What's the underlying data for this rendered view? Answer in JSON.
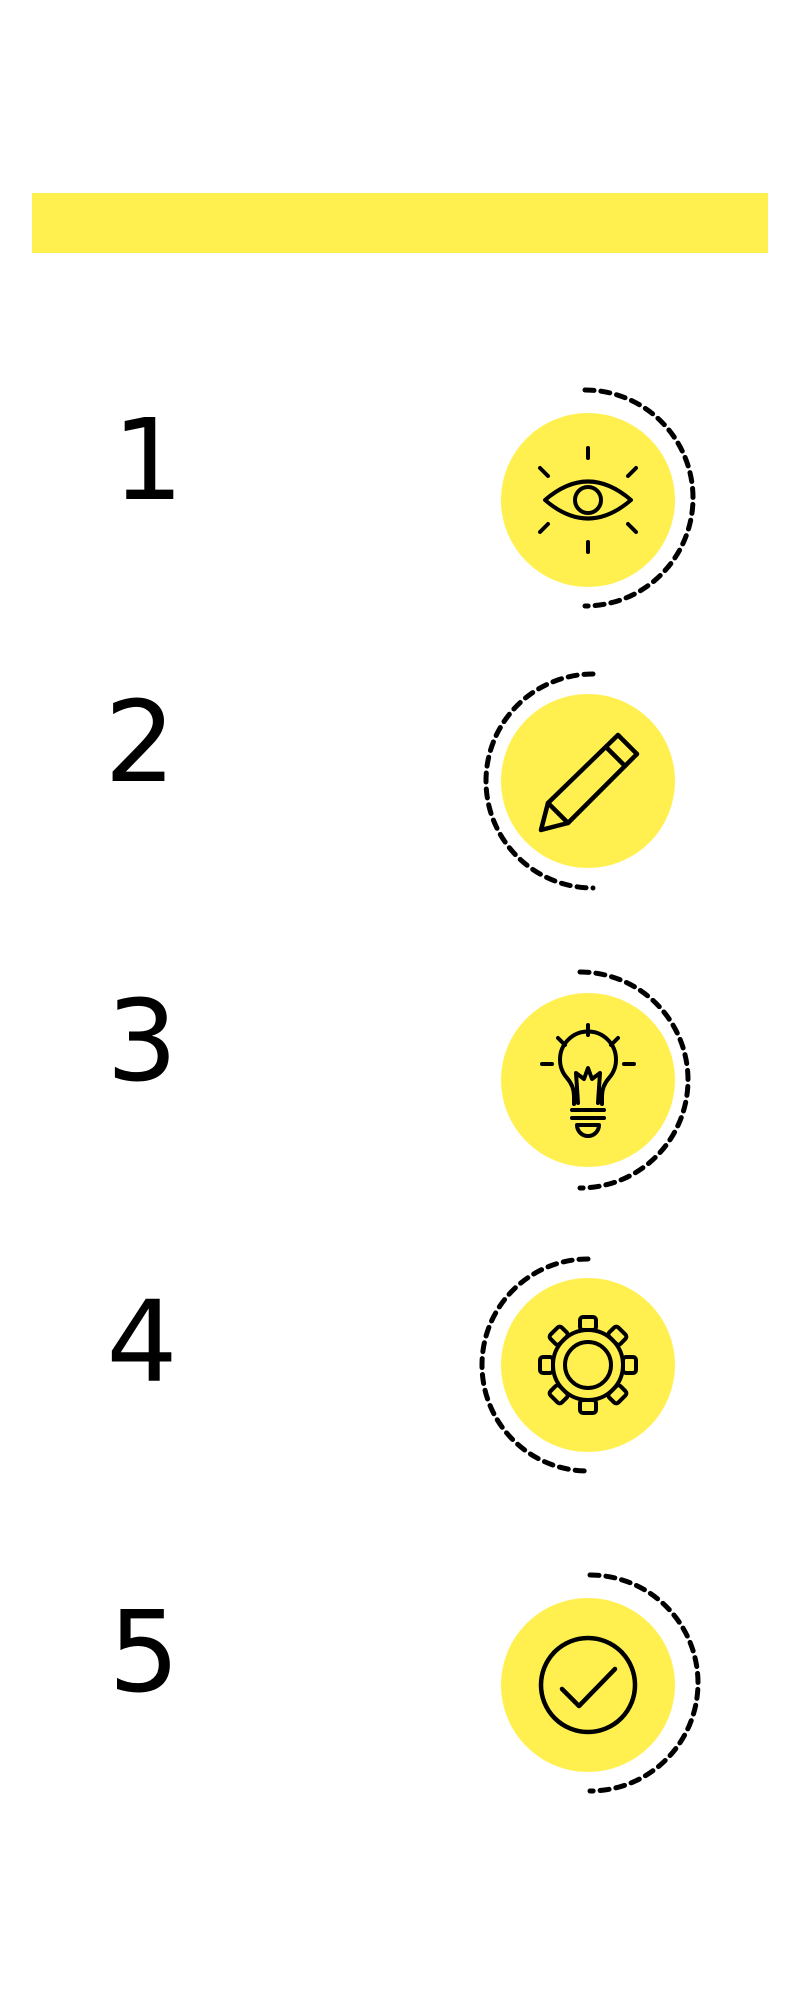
{
  "colors": {
    "accent": "#FFF04F",
    "ink": "#000000",
    "background": "#FFFFFF"
  },
  "steps": [
    {
      "number": "1",
      "icon": "eye-icon",
      "ring_side": "right"
    },
    {
      "number": "2",
      "icon": "pencil-icon",
      "ring_side": "left"
    },
    {
      "number": "3",
      "icon": "lightbulb-icon",
      "ring_side": "right"
    },
    {
      "number": "4",
      "icon": "gear-icon",
      "ring_side": "left"
    },
    {
      "number": "5",
      "icon": "checkmark-circle-icon",
      "ring_side": "right"
    }
  ]
}
